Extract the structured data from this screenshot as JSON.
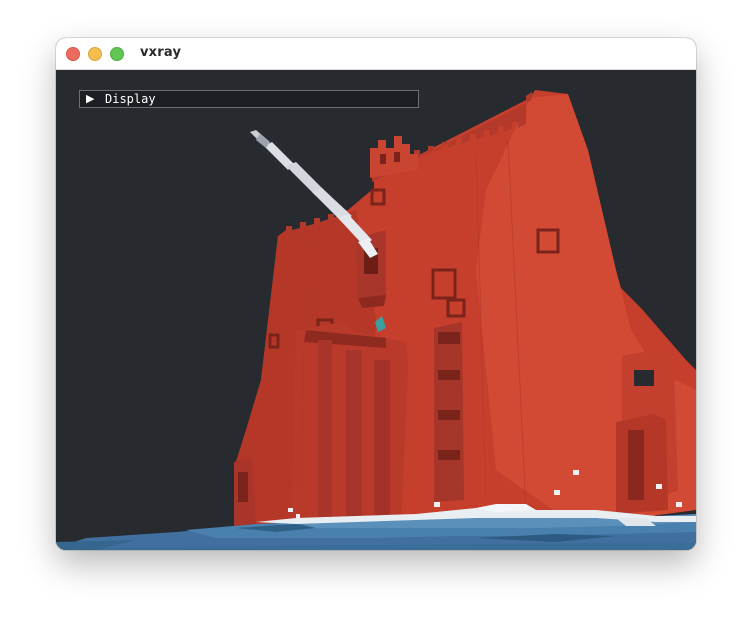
{
  "window": {
    "title": "vxray"
  },
  "overlay": {
    "panel_label": "Display",
    "expand_icon": "triangle-right-icon",
    "collapsed": true
  },
  "scene": {
    "background_color": "#272a2f",
    "building_color": "#c8412f",
    "water_color": "#3f74a0",
    "foam_color": "#e9eef2",
    "beam_color": "#d8dbe2"
  }
}
